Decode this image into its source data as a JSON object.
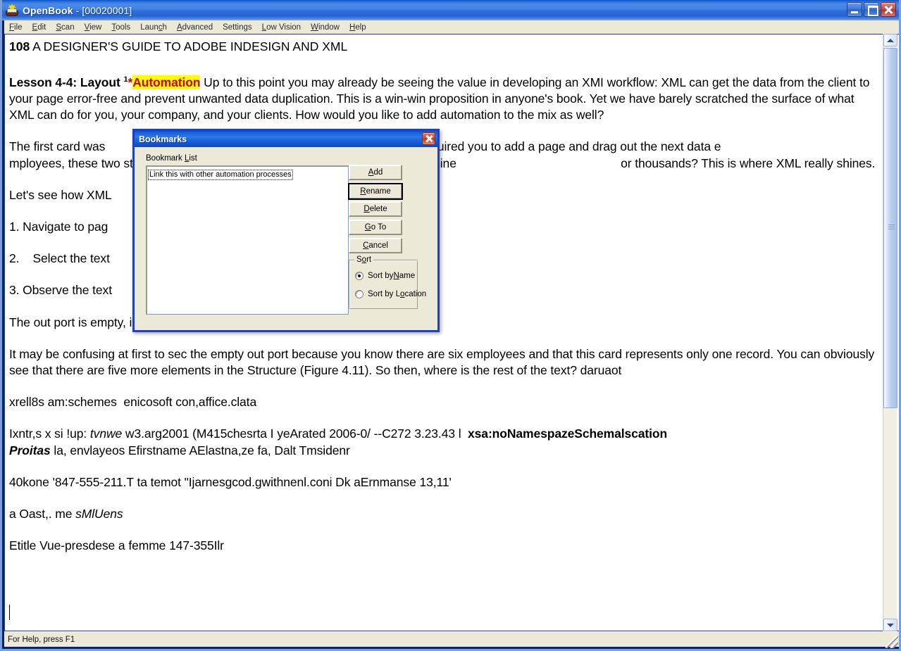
{
  "window": {
    "app_name": "OpenBook",
    "document_name": "[00020001]",
    "title": "OpenBook - [00020001]",
    "icon": "openbook-icon",
    "buttons": {
      "minimize": "minimize-icon",
      "maximize": "maximize-icon",
      "close": "close-icon"
    }
  },
  "menubar": {
    "items": [
      {
        "label": "File",
        "pre": "",
        "hotkey": "F",
        "post": "ile"
      },
      {
        "label": "Edit",
        "pre": "",
        "hotkey": "E",
        "post": "dit"
      },
      {
        "label": "Scan",
        "pre": "",
        "hotkey": "S",
        "post": "can"
      },
      {
        "label": "View",
        "pre": "",
        "hotkey": "V",
        "post": "iew"
      },
      {
        "label": "Tools",
        "pre": "",
        "hotkey": "T",
        "post": "ools"
      },
      {
        "label": "Launch",
        "pre": "Laun",
        "hotkey": "c",
        "post": "h"
      },
      {
        "label": "Advanced",
        "pre": "",
        "hotkey": "A",
        "post": "dvanced"
      },
      {
        "label": "Settings",
        "pre": "Settings",
        "hotkey": "",
        "post": ""
      },
      {
        "label": "Low Vision",
        "pre": "",
        "hotkey": "L",
        "post": "ow Vision"
      },
      {
        "label": "Window",
        "pre": "",
        "hotkey": "W",
        "post": "indow"
      },
      {
        "label": "Help",
        "pre": "",
        "hotkey": "H",
        "post": "elp"
      }
    ]
  },
  "document": {
    "page_header": {
      "page_number": "108",
      "running_title": " A DESIGNER'S GUIDE TO ADOBE INDESIGN AND XML"
    },
    "lesson": {
      "heading": "Lesson 4-4: Layout ",
      "footnote_marker": "1",
      "star": "*",
      "highlight": "Automation",
      "highlight_bg": "#ffff00",
      "highlight_color": "#d00000",
      "body": " Up to this point you may already be seeing the value in developing an XMI workflow: XML can get the data from the client to your page error-free and prevent unwanted data duplication. This is a win-win proposition in anyone's book. Yet we have barely scratched the surface of what XML can do for you, your company, and your clients. How would you like to add automation to the mix as well?"
    },
    "paragraphs": [
      "The first card was                                                   XML. But the second card required you to add a page and drag out the next data e                                                  mployees, these two steps would have to be repeated. Not a big deal for six busine                                                 or thousands? This is where XML really shines.",
      "Let's see how XML",
      "1. Navigate to pag",
      "2.    Select the text",
      "3. Observe the text",
      "The out port is empty, indicating that there is no more text to place.",
      "It may be confusing at first to sec the empty out port because you know there are six employees and that this card represents only one record. You can obviously see that there are five more elements in the Structure (Figure 4.11). So then, where is the rest of the text? daruaot",
      "xrell8s am:schemes  enicosoft con,affice.clata"
    ],
    "ocr_lines": {
      "line1_a": "Ixntr,s x si !up: ",
      "line1_italic": "tvnwe",
      "line1_b": " w3.arg2001 (M415chesrta I yeArated 2006-0/ --C272 3.23.43 l  ",
      "line1_bold": "xsa:noNamespazeSchemalscation",
      "line2_bolditalic": "Proitas",
      "line2_rest": " la, envlayeos Efirstname AElastna,ze fa, Dalt Tmsidenr",
      "line3": "40kone '847-555-211.T ta temot \"Ijarnesgcod.gwithnenl.coni Dk aErnmanse 13,11'",
      "line4_a": "a Oast,. me ",
      "line4_italic": "sMlUens",
      "line5": "Etitle Vue-presdese a femme 147-355Ilr"
    }
  },
  "scrollbar": {
    "up_arrow": "scroll-up-icon",
    "down_arrow": "scroll-down-icon",
    "thumb": "scroll-thumb"
  },
  "statusbar": {
    "message": "For Help, press F1"
  },
  "dialog": {
    "title": "Bookmarks",
    "close_icon": "close-icon",
    "list_label_pre": "Bookmark ",
    "list_label_hotkey": "L",
    "list_label_post": "ist",
    "list_items": [
      "Link this with other automation processes"
    ],
    "selected_item": "Link this with other automation processes",
    "buttons": [
      {
        "name": "add",
        "pre": "",
        "hotkey": "A",
        "post": "dd",
        "default": false
      },
      {
        "name": "rename",
        "pre": "",
        "hotkey": "R",
        "post": "ename",
        "default": true
      },
      {
        "name": "delete",
        "pre": "",
        "hotkey": "D",
        "post": "elete",
        "default": false
      },
      {
        "name": "goto",
        "pre": "",
        "hotkey": "G",
        "post": "o To",
        "default": false
      },
      {
        "name": "cancel",
        "pre": "",
        "hotkey": "C",
        "post": "ancel",
        "default": false
      }
    ],
    "sort": {
      "legend_pre": "S",
      "legend_hotkey": "o",
      "legend_post": "rt",
      "options": [
        {
          "pre": "Sort by ",
          "hotkey": "N",
          "post": "ame",
          "checked": true
        },
        {
          "pre": "Sort by L",
          "hotkey": "o",
          "post": "cation",
          "checked": false
        }
      ]
    }
  },
  "colors": {
    "titlebar_blue": "#2f6fde",
    "dialog_blue": "#1f68e0",
    "face": "#ece9d8",
    "highlight_yellow": "#ffff00",
    "highlight_red": "#d00000",
    "close_red": "#c03a1c"
  }
}
